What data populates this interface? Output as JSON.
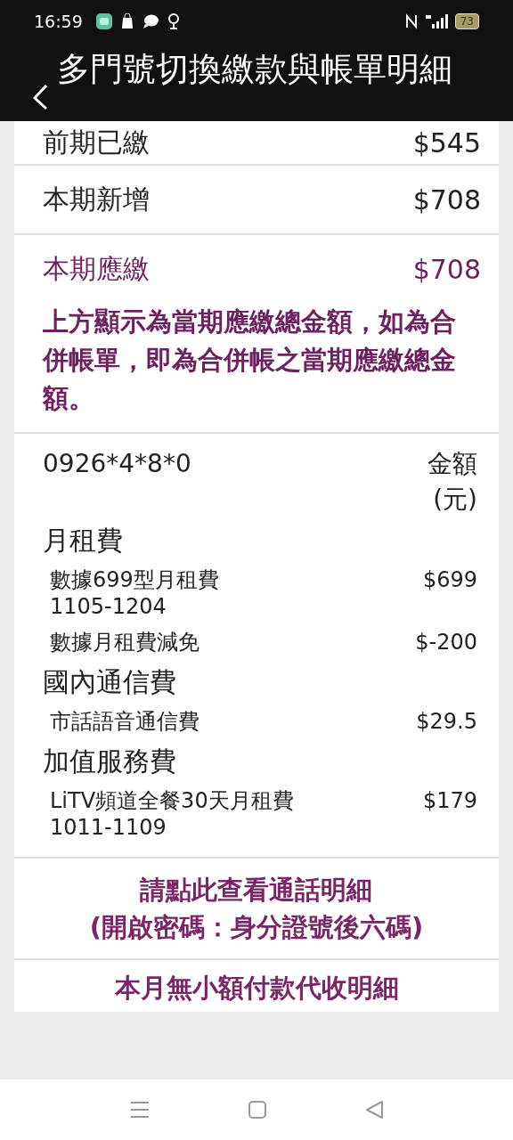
{
  "status_bar": {
    "time": "16:59",
    "battery": "73"
  },
  "header": {
    "title": "多門號切換繳款與帳單明細"
  },
  "summary": [
    {
      "label": "前期已繳",
      "amount": "$545",
      "kind": "normal"
    },
    {
      "label": "本期新增",
      "amount": "$708",
      "kind": "normal"
    },
    {
      "label": "本期應繳",
      "amount": "$708",
      "kind": "due"
    }
  ],
  "notice": "上方顯示為當期應繳總金額，如為合併帳單，即為合併帳之當期應繳總金額。",
  "detail": {
    "number": "0926*4*8*0",
    "amount_heading": "金額(元)",
    "categories": [
      {
        "name": "月租費",
        "items": [
          {
            "name": "數據699型月租費",
            "period": "1105-1204",
            "amount": "$699"
          },
          {
            "name": "數據月租費減免",
            "amount": "$-200"
          }
        ]
      },
      {
        "name": "國內通信費",
        "items": [
          {
            "name": "市話語音通信費",
            "amount": "$29.5"
          }
        ]
      },
      {
        "name": "加值服務費",
        "items": [
          {
            "name": "LiTV頻道全餐30天月租費",
            "period": "1011-1109",
            "amount": "$179"
          }
        ]
      }
    ]
  },
  "call_detail_link": "請點此查看通話明細\n(開啟密碼：身分證號後六碼)",
  "micropayment_link": "本月無小額付款代收明細"
}
